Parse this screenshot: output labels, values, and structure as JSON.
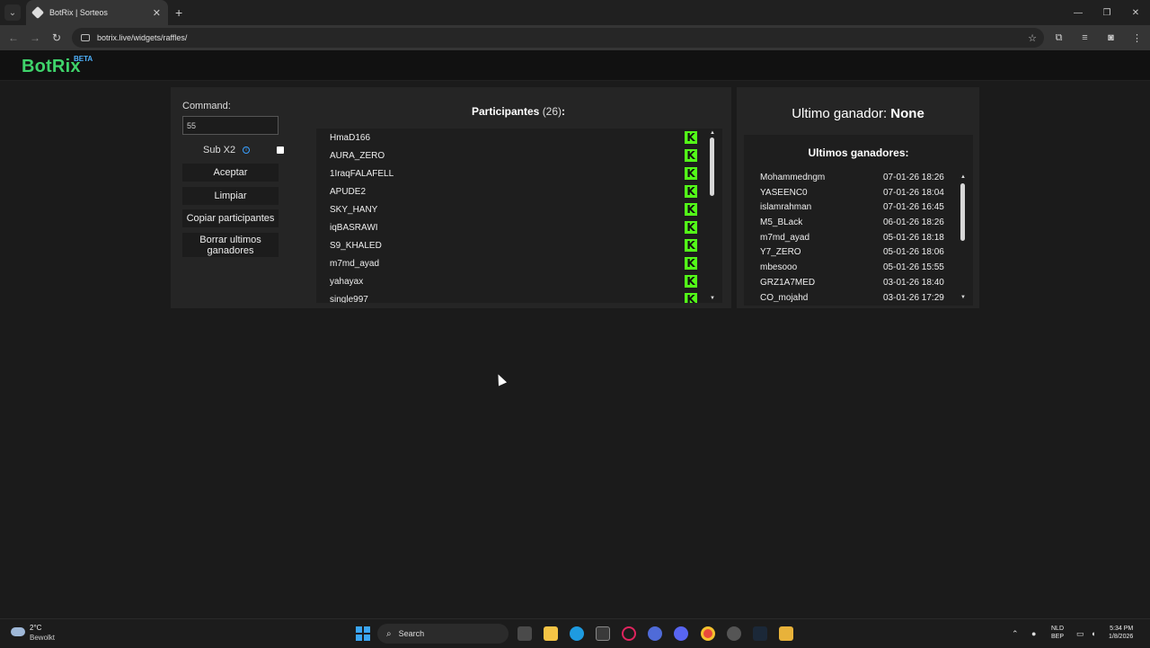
{
  "browser": {
    "tab_title": "BotRix | Sorteos",
    "url": "botrix.live/widgets/raffles/",
    "new_tab": "+",
    "close": "✕"
  },
  "site": {
    "logo": "BotRix",
    "beta": "BETA"
  },
  "controls": {
    "command_label": "Command:",
    "command_value": "55",
    "sub_label": "Sub X2",
    "sub_checked": false,
    "accept": "Aceptar",
    "clear": "Limpiar",
    "copy": "Copiar participantes",
    "delete_winners": "Borrar ultimos ganadores"
  },
  "participants": {
    "title": "Participantes",
    "count": "(26)",
    "colon": ":",
    "list": [
      "HmaD166",
      "AURA_ZERO",
      "1IraqFALAFELL",
      "APUDE2",
      "SKY_HANY",
      "iqBASRAWI",
      "S9_KHALED",
      "m7md_ayad",
      "yahayax",
      "single997"
    ]
  },
  "last_winner": {
    "label": "Ultimo ganador:",
    "value": "None"
  },
  "recent_winners": {
    "title": "Ultimos ganadores:",
    "list": [
      {
        "name": "Mohammedngm",
        "date": "07-01-26 18:26"
      },
      {
        "name": "YASEENC0",
        "date": "07-01-26 18:04"
      },
      {
        "name": "islamrahman",
        "date": "07-01-26 16:45"
      },
      {
        "name": "M5_BLack",
        "date": "06-01-26 18:26"
      },
      {
        "name": "m7md_ayad",
        "date": "05-01-26 18:18"
      },
      {
        "name": "Y7_ZERO",
        "date": "05-01-26 18:06"
      },
      {
        "name": "mbesooo",
        "date": "05-01-26 15:55"
      },
      {
        "name": "GRZ1A7MED",
        "date": "03-01-26 18:40"
      },
      {
        "name": "CO_mojahd",
        "date": "03-01-26 17:29"
      }
    ]
  },
  "taskbar": {
    "temp": "2°C",
    "weather": "Bewolkt",
    "search": "Search",
    "lang1": "NLD",
    "lang2": "BEP",
    "time": "5:34 PM",
    "date": "1/8/2026"
  },
  "colors": {
    "brand": "#3fd46b",
    "kick": "#53fc18",
    "beta": "#4fb3ff"
  }
}
